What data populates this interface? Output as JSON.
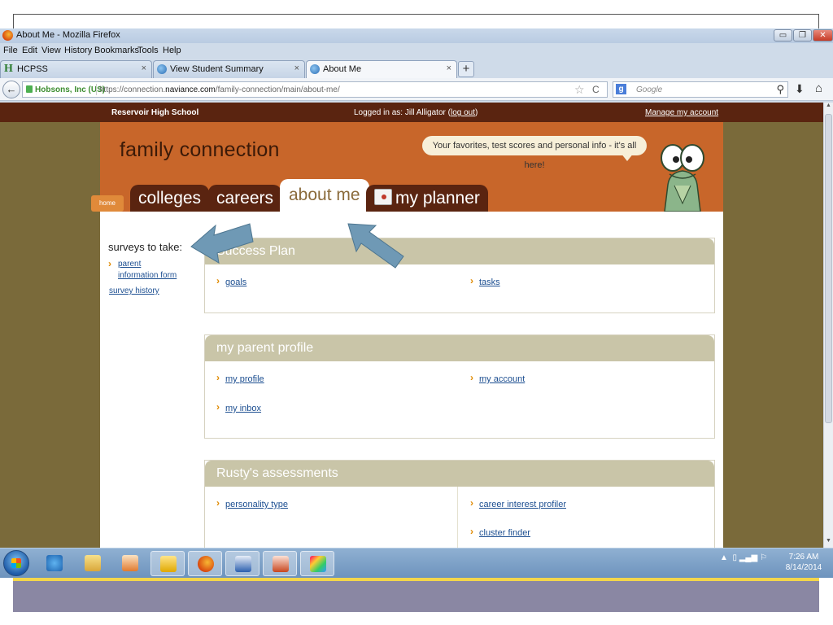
{
  "window": {
    "title": "About Me - Mozilla Firefox",
    "controls": {
      "minimize": "▭",
      "maximize": "❐",
      "close": "✕"
    }
  },
  "menubar": [
    "File",
    "Edit",
    "View",
    "History",
    "Bookmarks",
    "Tools",
    "Help"
  ],
  "tabs": [
    {
      "label": "HCPSS",
      "icon": "h-icon",
      "close": "×"
    },
    {
      "label": "View Student Summary",
      "icon": "globe-icon",
      "close": "×"
    },
    {
      "label": "About Me",
      "icon": "globe-icon",
      "close": "×",
      "active": true
    }
  ],
  "new_tab": "+",
  "navbar": {
    "back": "←",
    "identity": "Hobsons, Inc (US)",
    "url_prefix": "https://connection.",
    "url_domain": "naviance.com",
    "url_path": "/family-connection/main/about-me/",
    "star": "☆",
    "reload": "C",
    "search_engine": "g",
    "search_placeholder": "Google",
    "search_icon": "⚲",
    "download": "⬇",
    "home": "⌂"
  },
  "topstrip": {
    "school": "Reservoir High School",
    "logged_prefix": "Logged in as: Jill Alligator (",
    "logout": "log out",
    "logged_suffix": ")",
    "manage": "Manage my account"
  },
  "header": {
    "brand": "family connection",
    "speech": "Your favorites, test scores and personal info - it's all here!"
  },
  "nav_tabs": {
    "home": "home",
    "colleges": "colleges",
    "careers": "careers",
    "about": "about me",
    "planner": "my planner"
  },
  "sidebar": {
    "title": "surveys to take:",
    "item": "parent information form",
    "history": "survey history"
  },
  "panels": {
    "success": {
      "title": "Success Plan",
      "left": "goals",
      "right": "tasks"
    },
    "parent": {
      "title": "my parent profile",
      "left1": "my profile",
      "right1": "my account",
      "left2": "my inbox"
    },
    "assess": {
      "title": "Rusty's assessments",
      "left1": "personality type",
      "right1": "career interest profiler",
      "right2": "cluster finder"
    }
  },
  "taskbar": {
    "apps": [
      "windows-explorer",
      "internet-explorer",
      "file-explorer",
      "media-player",
      "outlook",
      "firefox",
      "word",
      "powerpoint",
      "paint"
    ],
    "active_app": "firefox",
    "clock_time": "7:26 AM",
    "clock_date": "8/14/2014",
    "tray": "▲"
  },
  "colors": {
    "brown_dark": "#5a2410",
    "orange": "#c8662a",
    "panel_head": "#c9c5a8",
    "link": "#1d4f91",
    "arrow": "#6f99b5"
  }
}
